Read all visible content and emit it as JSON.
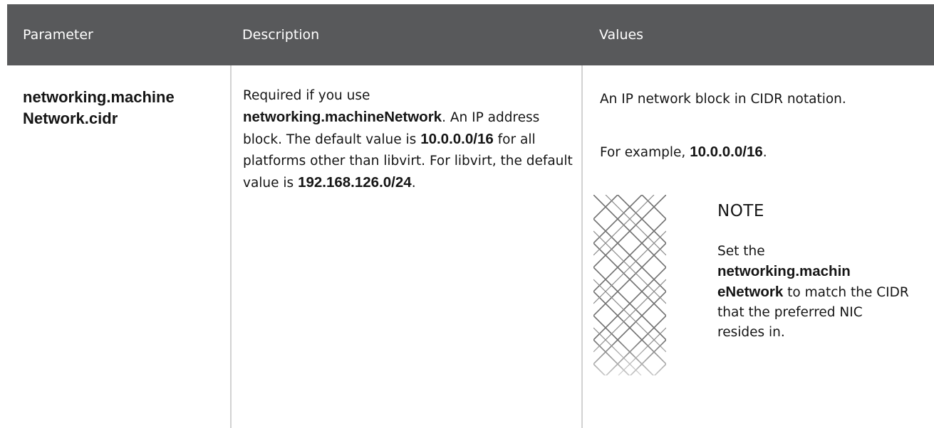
{
  "table": {
    "headers": {
      "parameter": "Parameter",
      "description": "Description",
      "values": "Values"
    },
    "row": {
      "parameter_part1": "networking.machine",
      "parameter_part2": "Network.cidr",
      "description": {
        "t1": "Required if you use",
        "b1": "networking.machineNetwork",
        "t2": ". An IP address block. The default value is ",
        "b2": "10.0.0.0/16",
        "t3": " for all platforms other than libvirt. For libvirt, the default value is ",
        "b3": "192.168.126.0/24",
        "t4": "."
      },
      "values": {
        "line1": "An IP network block in CIDR notation.",
        "example_prefix": "For example, ",
        "example_value": "10.0.0.0/16",
        "example_suffix": "."
      },
      "note": {
        "icon": "note-pattern-icon",
        "title": "NOTE",
        "t1": "Set the ",
        "b1_part1": "networking.machin",
        "b1_part2": "eNetwork",
        "t2": " to match the CIDR that the preferred NIC resides in."
      }
    }
  },
  "colors": {
    "header_bg": "#58595b",
    "header_text": "#ffffff",
    "divider": "#d2d2d2",
    "text": "#151515"
  }
}
